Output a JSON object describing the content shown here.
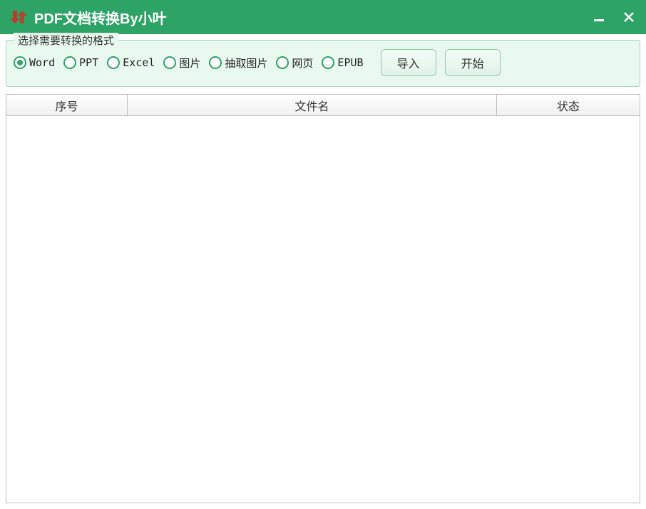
{
  "window": {
    "title": "PDF文档转换By小叶"
  },
  "fieldset": {
    "legend": "选择需要转换的格式"
  },
  "formats": [
    {
      "label": "Word",
      "checked": true
    },
    {
      "label": "PPT",
      "checked": false
    },
    {
      "label": "Excel",
      "checked": false
    },
    {
      "label": "图片",
      "checked": false
    },
    {
      "label": "抽取图片",
      "checked": false
    },
    {
      "label": "网页",
      "checked": false
    },
    {
      "label": "EPUB",
      "checked": false
    }
  ],
  "buttons": {
    "import": "导入",
    "start": "开始"
  },
  "table": {
    "columns": {
      "index": "序号",
      "filename": "文件名",
      "status": "状态"
    },
    "rows": []
  },
  "colors": {
    "accent": "#2ea366",
    "panel": "#eaf9f0"
  }
}
